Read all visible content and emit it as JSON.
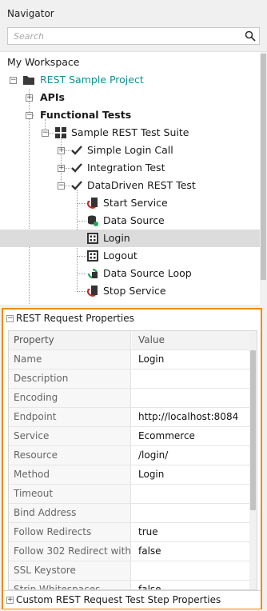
{
  "navigator": {
    "title": "Navigator",
    "search_placeholder": "Search"
  },
  "tree": {
    "workspace": "My Workspace",
    "project": "REST Sample Project",
    "apis": "APIs",
    "functional_tests": "Functional Tests",
    "suite": "Sample REST Test Suite",
    "cases": [
      "Simple Login Call",
      "Integration Test",
      "DataDriven REST Test"
    ],
    "steps": [
      "Start Service",
      "Data Source",
      "Login",
      "Logout",
      "Data Source Loop",
      "Stop Service"
    ],
    "selected_step": "Login"
  },
  "properties": {
    "header": "REST Request Properties",
    "col_property": "Property",
    "col_value": "Value",
    "rows": [
      {
        "name": "Name",
        "value": "Login"
      },
      {
        "name": "Description",
        "value": ""
      },
      {
        "name": "Encoding",
        "value": ""
      },
      {
        "name": "Endpoint",
        "value": "http://localhost:8084"
      },
      {
        "name": "Service",
        "value": "Ecommerce"
      },
      {
        "name": "Resource",
        "value": "/login/"
      },
      {
        "name": "Method",
        "value": "Login"
      },
      {
        "name": "Timeout",
        "value": ""
      },
      {
        "name": "Bind Address",
        "value": ""
      },
      {
        "name": "Follow Redirects",
        "value": "true"
      },
      {
        "name": "Follow 302 Redirect with ...",
        "value": "false"
      },
      {
        "name": "SSL Keystore",
        "value": ""
      },
      {
        "name": "Strip Whitespaces",
        "value": "false"
      }
    ],
    "custom_section": "Custom REST Request Test Step Properties"
  },
  "colors": {
    "accent_border": "#ef8a12",
    "project_text": "#148f8f",
    "selected_row": "#dcdcdc"
  }
}
